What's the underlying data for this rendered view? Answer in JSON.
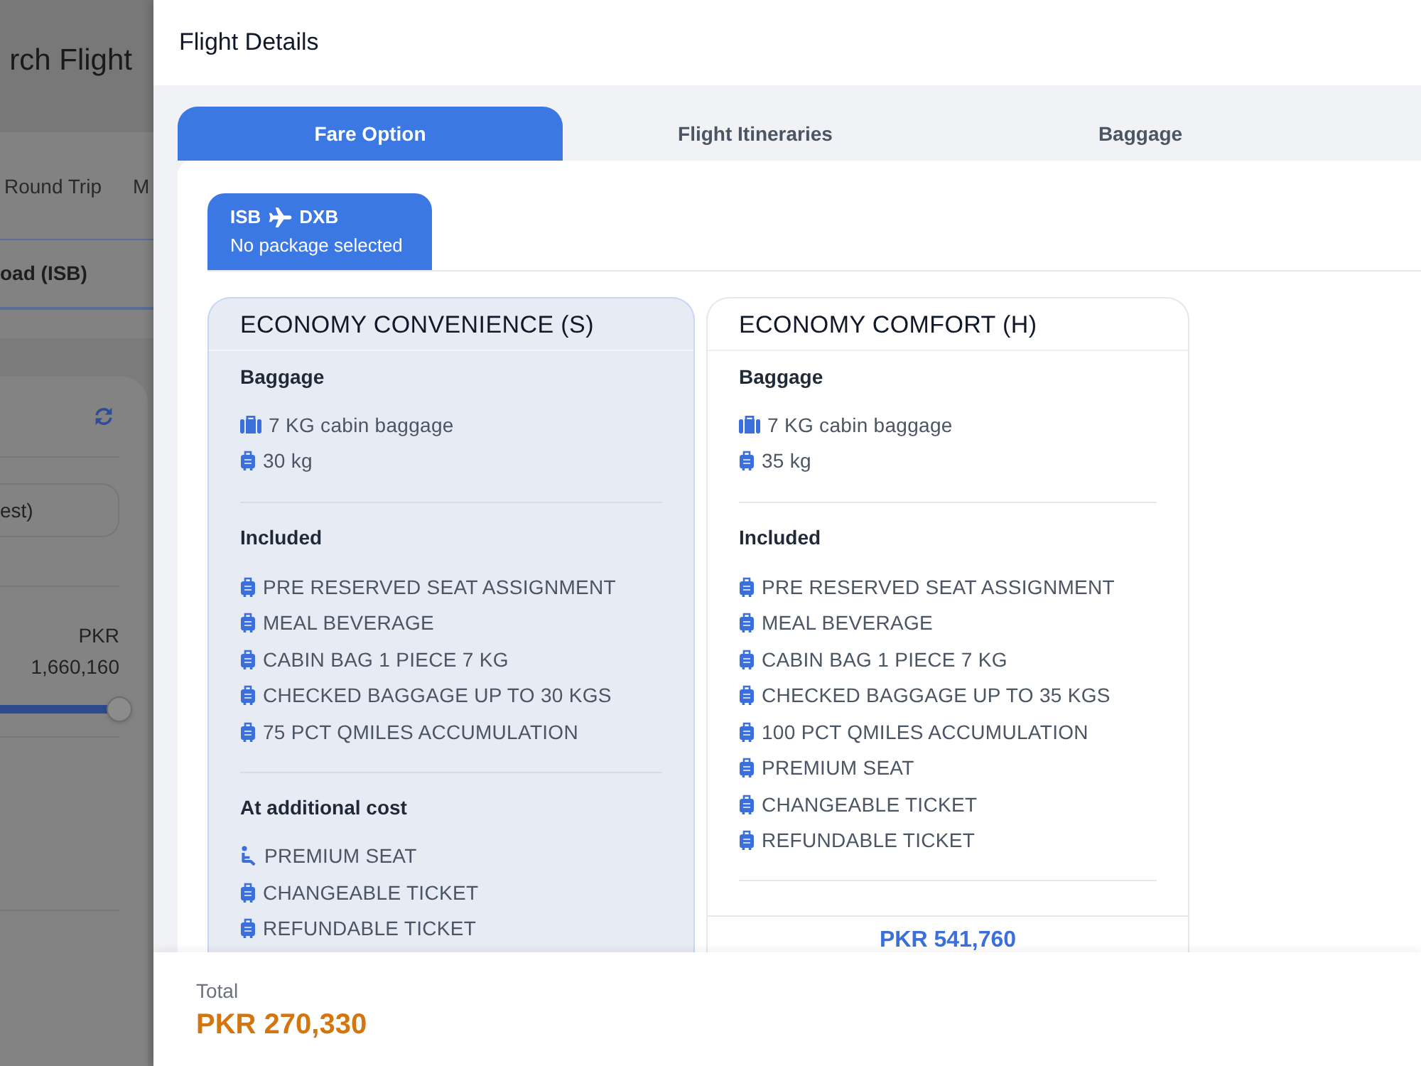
{
  "background_page": {
    "title": "rch Flight",
    "trip_types": [
      {
        "label": "Round Trip"
      },
      {
        "label": "M"
      }
    ],
    "origin_field": {
      "value": "oad (ISB)"
    },
    "sort_field": {
      "value": "est)"
    },
    "price_filter": {
      "currency": "PKR",
      "max_value": "1,660,160",
      "level": 1
    }
  },
  "drawer": {
    "title": "Flight Details",
    "tabs": [
      {
        "label": "Fare Option",
        "selected": true
      },
      {
        "label": "Flight Itineraries",
        "selected": false
      },
      {
        "label": "Baggage",
        "selected": false
      }
    ],
    "segments": [
      {
        "origin": "ISB",
        "destination": "DXB",
        "status": "No package selected",
        "selected": true
      }
    ],
    "fare_options": [
      {
        "name": "ECONOMY CONVENIENCE (S)",
        "selected": true,
        "sections": [
          {
            "title": "Baggage",
            "items": [
              {
                "kind": "cabin",
                "text": "7 KG cabin baggage"
              },
              {
                "kind": "luggage",
                "text": "30 kg"
              }
            ]
          },
          {
            "title": "Included",
            "items": [
              {
                "kind": "luggage",
                "text": "PRE RESERVED SEAT ASSIGNMENT"
              },
              {
                "kind": "luggage",
                "text": "MEAL BEVERAGE"
              },
              {
                "kind": "luggage",
                "text": "CABIN BAG 1 PIECE 7 KG"
              },
              {
                "kind": "luggage",
                "text": "CHECKED BAGGAGE UP TO 30 KGS"
              },
              {
                "kind": "luggage",
                "text": "75 PCT QMILES ACCUMULATION"
              }
            ]
          },
          {
            "title": "At additional cost",
            "items": [
              {
                "kind": "seat",
                "text": "PREMIUM SEAT"
              },
              {
                "kind": "luggage",
                "text": "CHANGEABLE TICKET"
              },
              {
                "kind": "luggage",
                "text": "REFUNDABLE TICKET"
              }
            ]
          }
        ]
      },
      {
        "name": "ECONOMY COMFORT (H)",
        "selected": false,
        "sections": [
          {
            "title": "Baggage",
            "items": [
              {
                "kind": "cabin",
                "text": "7 KG cabin baggage"
              },
              {
                "kind": "luggage",
                "text": "35 kg"
              }
            ]
          },
          {
            "title": "Included",
            "items": [
              {
                "kind": "luggage",
                "text": "PRE RESERVED SEAT ASSIGNMENT"
              },
              {
                "kind": "luggage",
                "text": "MEAL BEVERAGE"
              },
              {
                "kind": "luggage",
                "text": "CABIN BAG 1 PIECE 7 KG"
              },
              {
                "kind": "luggage",
                "text": "CHECKED BAGGAGE UP TO 35 KGS"
              },
              {
                "kind": "luggage",
                "text": "100 PCT QMILES ACCUMULATION"
              },
              {
                "kind": "luggage",
                "text": "PREMIUM SEAT"
              },
              {
                "kind": "luggage",
                "text": "CHANGEABLE TICKET"
              },
              {
                "kind": "luggage",
                "text": "REFUNDABLE TICKET"
              }
            ]
          }
        ],
        "price": "PKR 541,760"
      }
    ],
    "footer": {
      "label": "Total",
      "amount": "PKR 270,330"
    }
  }
}
